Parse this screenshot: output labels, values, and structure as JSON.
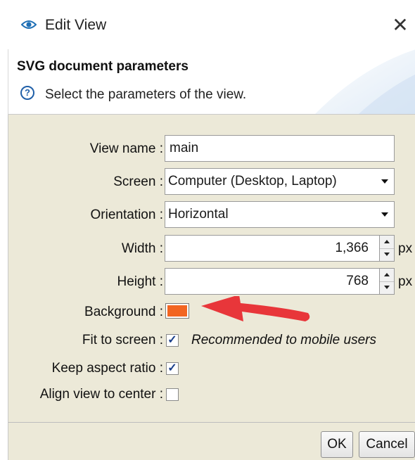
{
  "window": {
    "title": "Edit View",
    "title_icon": "eye-icon",
    "close_glyph": "✕"
  },
  "header": {
    "title": "SVG document parameters",
    "description": "Select the parameters of the view.",
    "help_icon": "help-icon",
    "help_glyph": "?"
  },
  "form": {
    "view_name": {
      "label": "View name :",
      "value": "main"
    },
    "screen": {
      "label": "Screen :",
      "value": "Computer (Desktop, Laptop)"
    },
    "orientation": {
      "label": "Orientation :",
      "value": "Horizontal"
    },
    "width": {
      "label": "Width :",
      "value": "1,366",
      "unit": "px"
    },
    "height": {
      "label": "Height :",
      "value": "768",
      "unit": "px"
    },
    "background": {
      "label": "Background :",
      "color": "#f26522"
    },
    "fit_to_screen": {
      "label": "Fit to screen :",
      "checked": true,
      "note": "Recommended to mobile users"
    },
    "keep_aspect_ratio": {
      "label": "Keep aspect ratio :",
      "checked": true
    },
    "align_view_to_center": {
      "label": "Align view to center :",
      "checked": false
    },
    "check_glyph": "✓"
  },
  "annotation": {
    "arrow_color": "#e8363a"
  },
  "buttons": {
    "ok": "OK",
    "cancel": "Cancel"
  }
}
